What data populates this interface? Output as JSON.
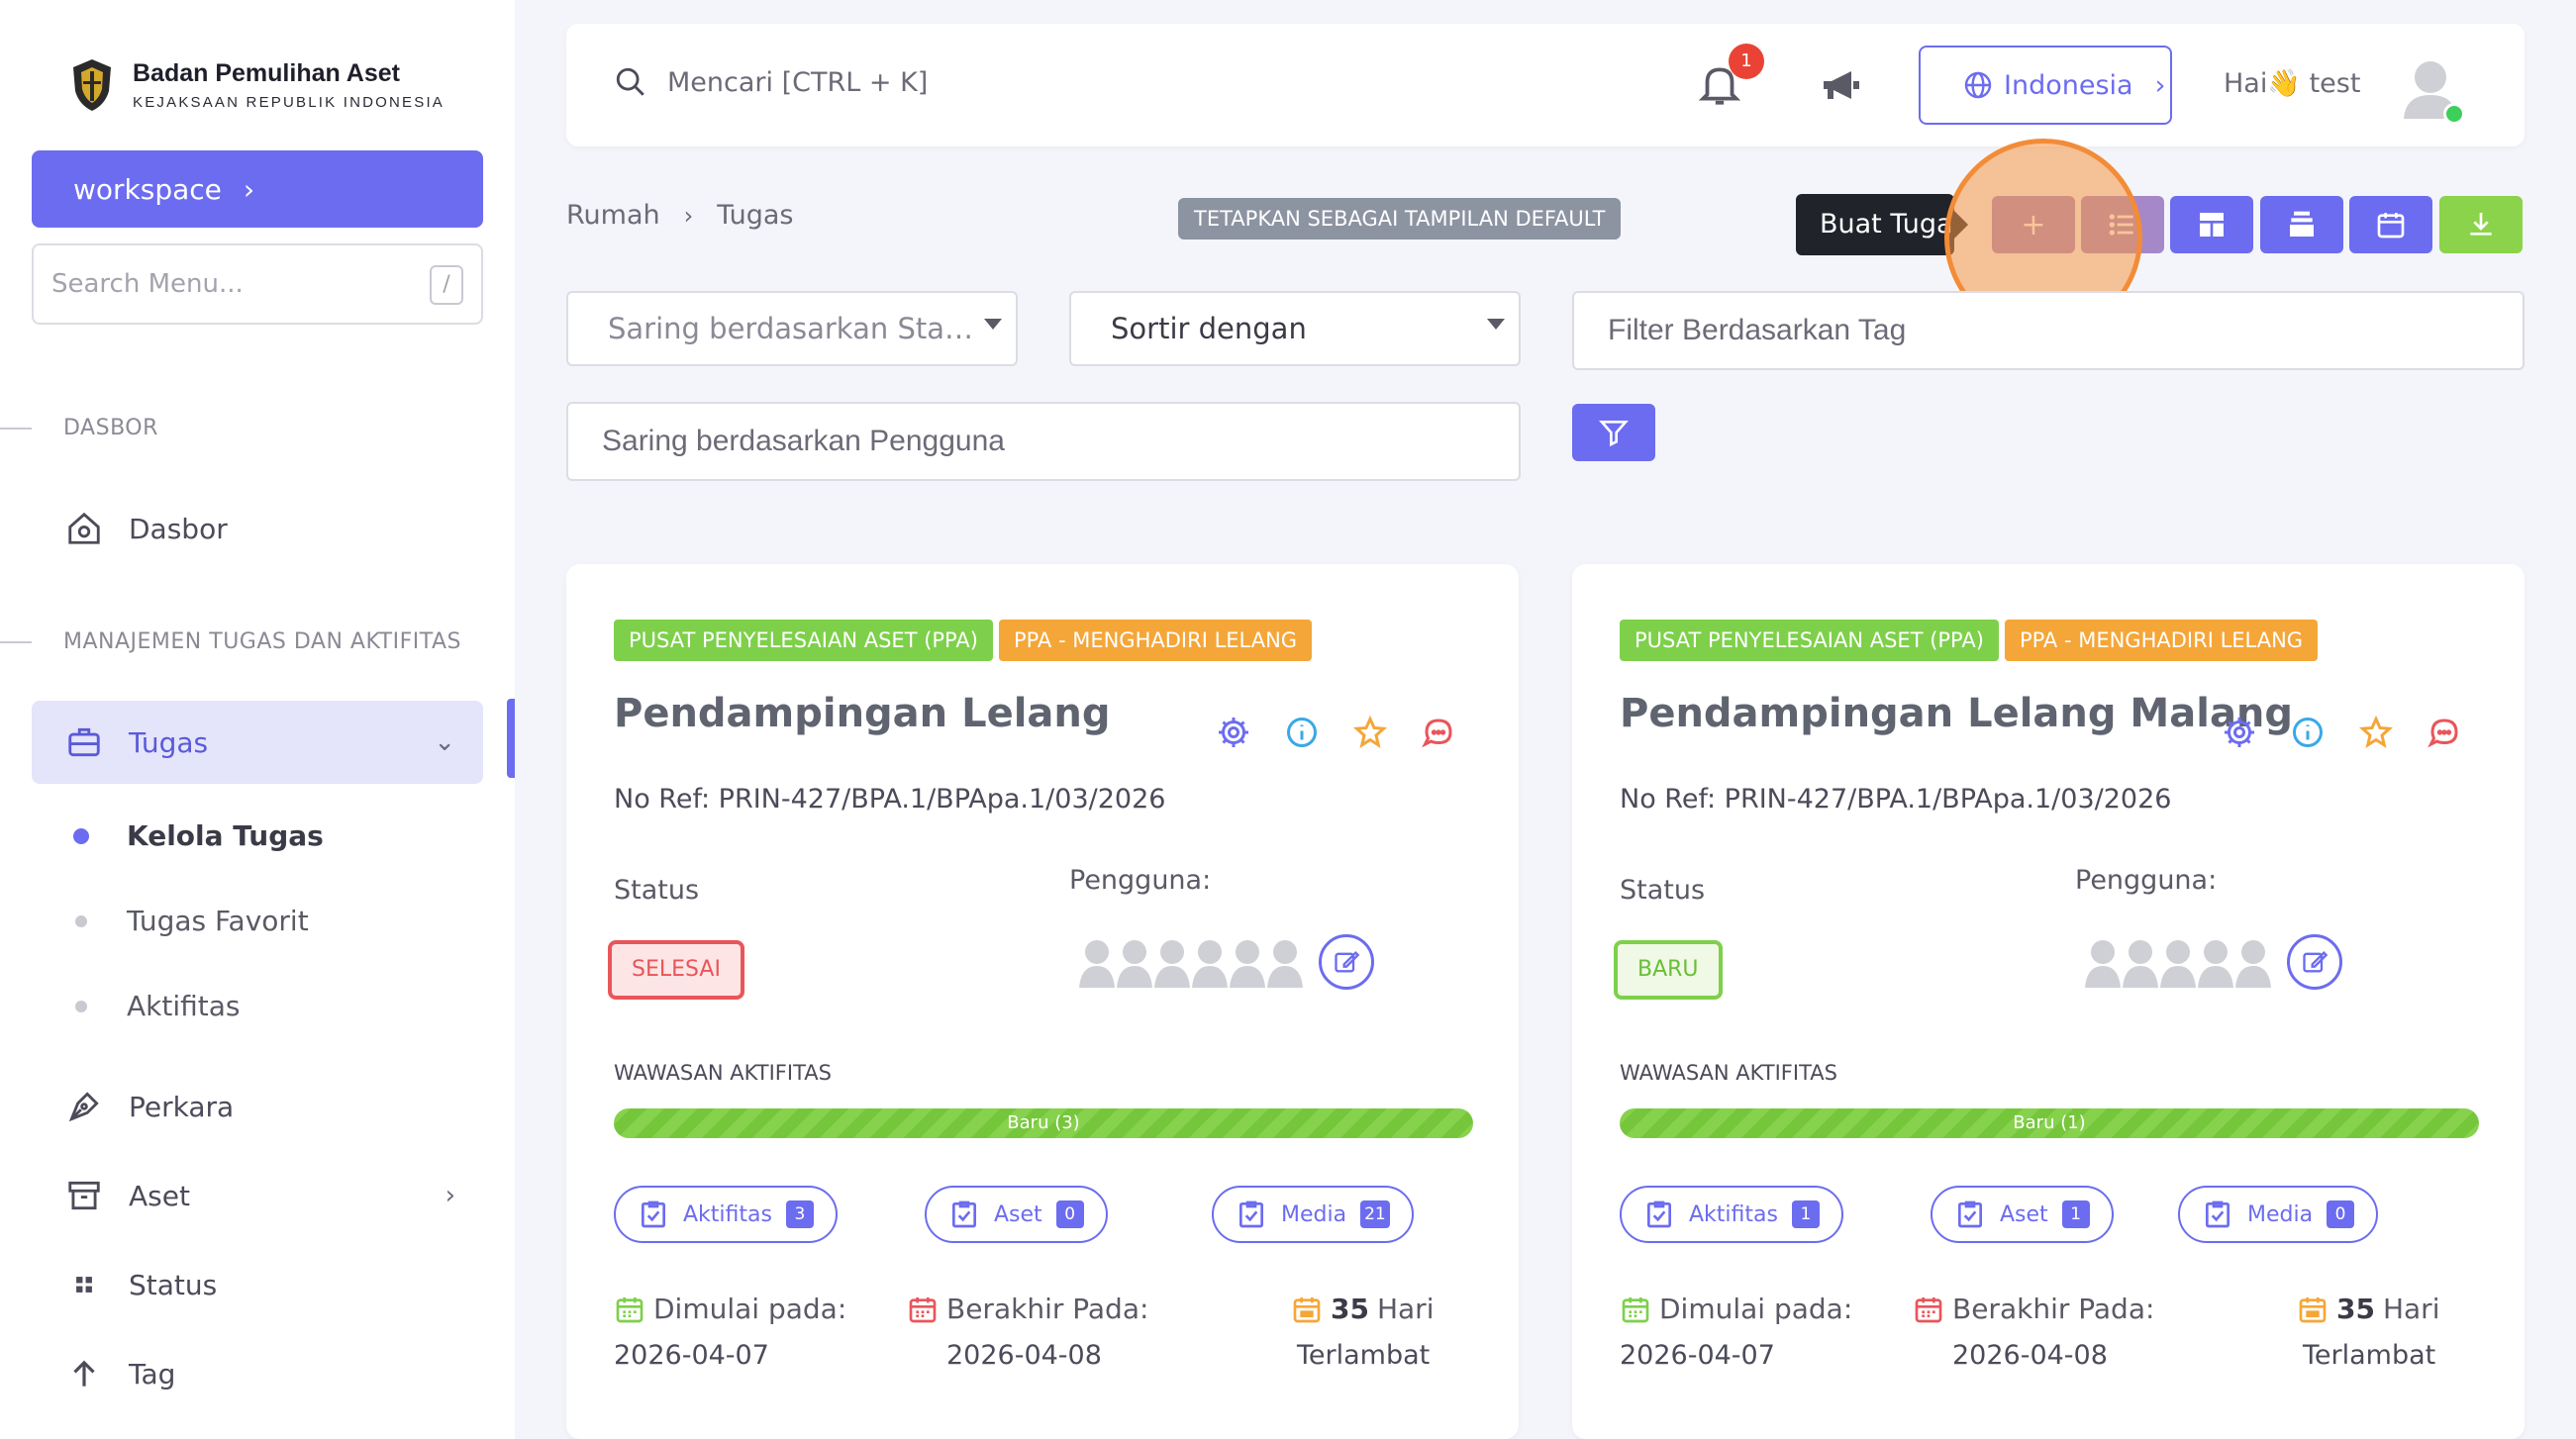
{
  "brand": {
    "title": "Badan Pemulihan Aset",
    "subtitle": "KEJAKSAAN REPUBLIK INDONESIA"
  },
  "sidebar": {
    "workspace_label": "workspace",
    "search_placeholder": "Search Menu...",
    "search_shortcut": "/",
    "section_dashboard": "DASBOR",
    "section_tasks": "MANAJEMEN TUGAS DAN AKTIFITAS",
    "items": {
      "dasbor": "Dasbor",
      "tugas": "Tugas",
      "perkara": "Perkara",
      "aset": "Aset",
      "status": "Status",
      "tag": "Tag"
    },
    "sub_items": {
      "kelola": "Kelola Tugas",
      "favorit": "Tugas Favorit",
      "aktifitas": "Aktifitas"
    }
  },
  "topbar": {
    "search_placeholder": "Mencari [CTRL + K]",
    "notification_count": "1",
    "language": "Indonesia",
    "greeting_prefix": "Hai",
    "greeting_emoji": "👋",
    "greeting_name": "test"
  },
  "breadcrumb": {
    "home": "Rumah",
    "current": "Tugas"
  },
  "toolbar": {
    "default_view_label": "TETAPKAN SEBAGAI TAMPILAN DEFAULT",
    "tooltip": "Buat Tugas",
    "add_label": "+"
  },
  "filters": {
    "status_placeholder": "Saring berdasarkan Sta…",
    "sort_placeholder": "Sortir dengan",
    "tag_placeholder": "Filter Berdasarkan Tag",
    "user_placeholder": "Saring berdasarkan Pengguna"
  },
  "labels": {
    "status": "Status",
    "users": "Pengguna:",
    "insight": "WAWASAN AKTIFITAS",
    "started": "Dimulai pada:",
    "ended": "Berakhir Pada:",
    "late_unit": "Hari",
    "late": "Terlambat"
  },
  "cards": [
    {
      "tag1": "PUSAT PENYELESAIAN ASET (PPA)",
      "tag2": "PPA - MENGHADIRI LELANG",
      "title": "Pendampingan Lelang",
      "ref": "No Ref: PRIN-427/BPA.1/BPApa.1/03/2026",
      "status": "SELESAI",
      "progress_label": "Baru (3)",
      "progress_fraction": 1.0,
      "aktifitas_label": "Aktifitas",
      "aktifitas_count": "3",
      "aset_label": "Aset",
      "aset_count": "0",
      "media_label": "Media",
      "media_count": "21",
      "start_date": "2026-04-07",
      "end_date": "2026-04-08",
      "late_days": "35"
    },
    {
      "tag1": "PUSAT PENYELESAIAN ASET (PPA)",
      "tag2": "PPA - MENGHADIRI LELANG",
      "title": "Pendampingan Lelang Malang",
      "ref": "No Ref: PRIN-427/BPA.1/BPApa.1/03/2026",
      "status": "BARU",
      "progress_label": "Baru (1)",
      "progress_fraction": 1.0,
      "aktifitas_label": "Aktifitas",
      "aktifitas_count": "1",
      "aset_label": "Aset",
      "aset_count": "1",
      "media_label": "Media",
      "media_count": "0",
      "start_date": "2026-04-07",
      "end_date": "2026-04-08",
      "late_days": "35"
    }
  ],
  "colors": {
    "primary": "#6c6cf0",
    "success": "#7ed04a",
    "warning": "#f5a638",
    "danger": "#e9555a"
  }
}
